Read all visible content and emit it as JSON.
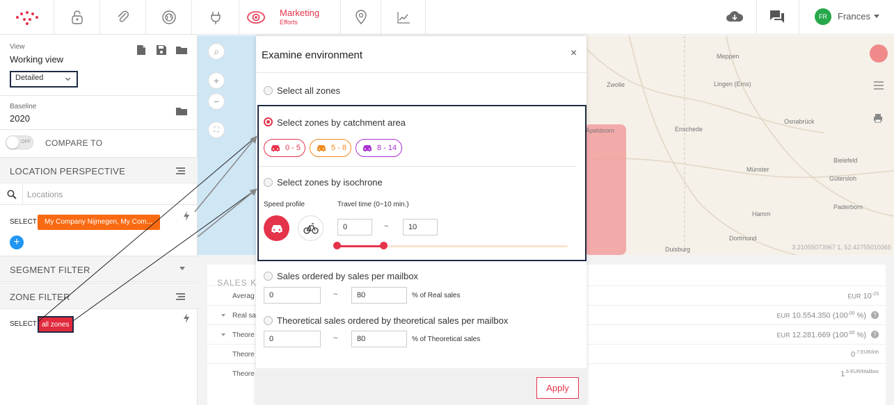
{
  "topbar": {
    "marketing_title": "Marketing",
    "marketing_sub": "Efforts",
    "user_initials": "FR",
    "user_name": "Frances"
  },
  "view": {
    "label": "View",
    "name": "Working view",
    "mode": "Detailed"
  },
  "baseline": {
    "label": "Baseline",
    "value": "2020"
  },
  "compare": {
    "toggle_state": "OFF",
    "label": "COMPARE TO"
  },
  "location_perspective": {
    "title": "LOCATION PERSPECTIVE",
    "search_placeholder": "Locations",
    "select_label": "SELECT",
    "chip": "My Company Nijmegen, My Com...",
    "add": "+"
  },
  "segment_filter": {
    "title": "SEGMENT FILTER"
  },
  "zone_filter": {
    "title": "ZONE FILTER",
    "select_label": "SELECT",
    "chip": "all zones"
  },
  "map": {
    "cities": [
      "Meppen",
      "Lingen (Ems)",
      "Zwolle",
      "Apeldoorn",
      "Enschede",
      "Osnabrück",
      "Münster",
      "Bielefeld",
      "Gütersloh",
      "Hamm",
      "Paderborn",
      "Dortmund",
      "Duisburg"
    ],
    "coords": "3.21055073967 1, 52.42755010365"
  },
  "kpi": {
    "title": "SALES KP",
    "rows": [
      {
        "name": "Averag",
        "value_prefix": "EUR",
        "value": "10",
        "value_sup": "-23"
      },
      {
        "name": "Real sa",
        "value_prefix": "EUR",
        "value": "10.554.350 (100",
        "value_sup": ".00",
        "value_suffix": " %)"
      },
      {
        "name": "Theore",
        "value_prefix": "EUR",
        "value": "12.281.669 (100",
        "value_sup": ".00",
        "value_suffix": " %)"
      },
      {
        "name": "Theore",
        "value": "0",
        "value_sup": ".7 EUR/inh"
      },
      {
        "name": "Theore",
        "value": "1",
        "value_sup": ".6 EUR/Mailbox"
      }
    ]
  },
  "modal": {
    "title": "Examine environment",
    "close": "×",
    "opt_all": "Select all zones",
    "opt_catchment": "Select zones by catchment area",
    "pills": [
      {
        "label": "0 - 5",
        "color": "#e5334b"
      },
      {
        "label": "5 - 8",
        "color": "#f08a1c"
      },
      {
        "label": "8 - 14",
        "color": "#a92fd3"
      }
    ],
    "opt_isochrone": "Select zones by isochrone",
    "speed_label": "Speed profile",
    "travel_label": "Travel time (0~10 min.)",
    "travel_min": "0",
    "travel_max": "10",
    "tilde": "~",
    "opt_sales": "Sales ordered by sales per mailbox",
    "sales_min": "0",
    "sales_max": "80",
    "sales_unit": "% of Real sales",
    "opt_theoretical": "Theoretical sales ordered by theoretical sales per mailbox",
    "theo_min": "0",
    "theo_max": "80",
    "theo_unit": "% of Theoretical sales",
    "apply": "Apply"
  },
  "colors": {
    "accent": "#e5334b",
    "orange": "#fa6a12",
    "blue": "#2196f3",
    "focus_border": "#1e2a44"
  }
}
